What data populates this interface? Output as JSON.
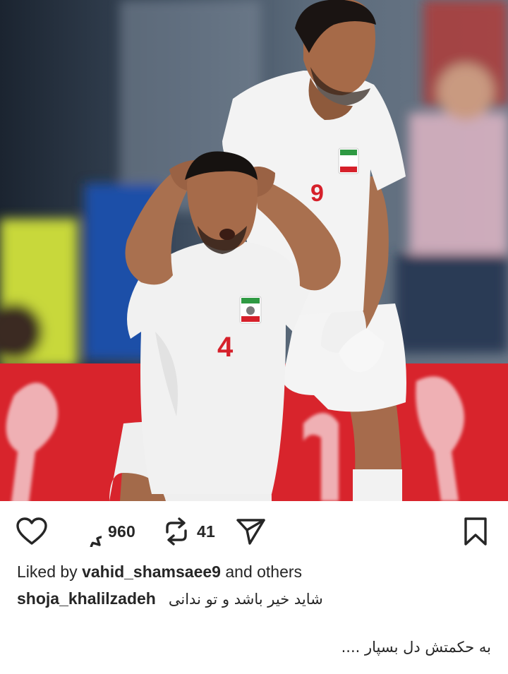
{
  "post": {
    "image": {
      "description_icon": "football-photo",
      "player_front_number": "4",
      "player_back_number": "9"
    },
    "actions": {
      "like_icon": "heart-icon",
      "comment_icon": "comment-icon",
      "comment_count": "960",
      "repost_icon": "repost-icon",
      "repost_count": "41",
      "share_icon": "send-icon",
      "save_icon": "bookmark-icon"
    },
    "likes": {
      "prefix": "Liked by",
      "user": "vahid_shamsaee9",
      "suffix": "and others"
    },
    "caption": {
      "username": "shoja_khalilzadeh",
      "text_line1": "شاید خیر باشد و تو ندانی",
      "text_line2": "به حکمتش دل بسپار ...."
    }
  },
  "colors": {
    "text": "#262626",
    "background": "#ffffff",
    "jersey_number": "#d6202a",
    "banner_red": "#d8242c"
  }
}
